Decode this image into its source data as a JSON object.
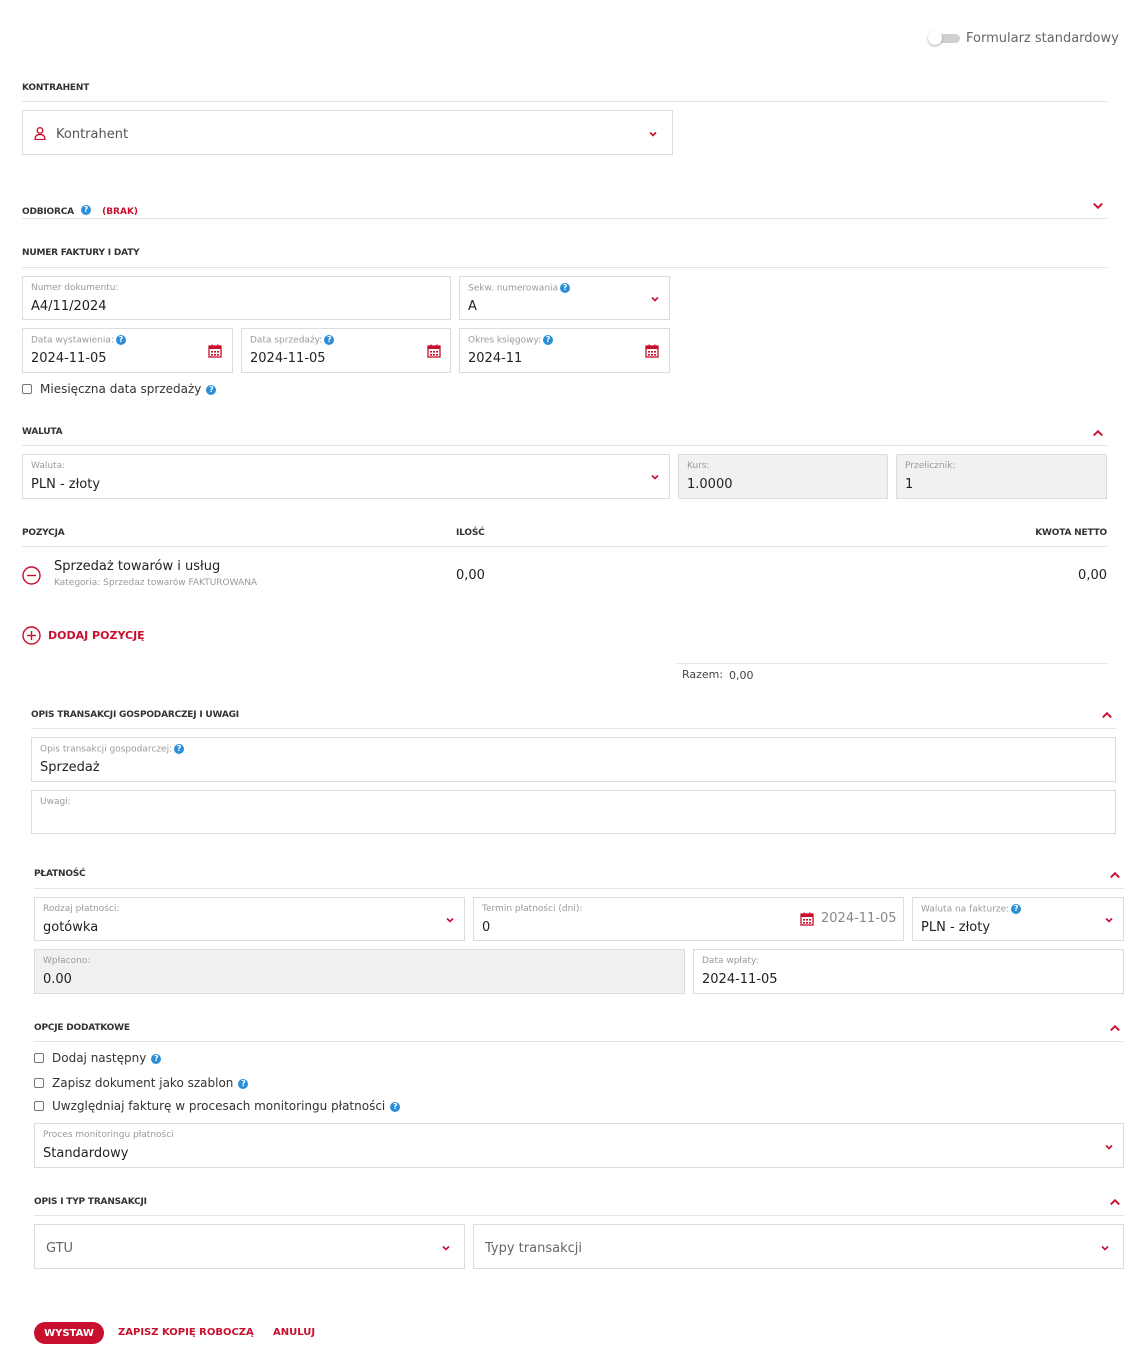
{
  "toggle": {
    "label": "Formularz standardowy"
  },
  "kontrahent": {
    "section_title": "KONTRAHENT",
    "placeholder": "Kontrahent"
  },
  "odbiorca": {
    "title": "ODBIORCA",
    "status": "(BRAK)"
  },
  "numer": {
    "section_title": "NUMER FAKTURY I DATY",
    "doc_label": "Numer dokumentu:",
    "doc_value": "A4/11/2024",
    "seq_label": "Sekw. numerowania",
    "seq_value": "A",
    "issue_label": "Data wystawienia:",
    "issue_value": "2024-11-05",
    "sale_label": "Data sprzedaży:",
    "sale_value": "2024-11-05",
    "period_label": "Okres księgowy:",
    "period_value": "2024-11",
    "monthly_label": "Miesięczna data sprzedaży"
  },
  "waluta": {
    "section_title": "WALUTA",
    "currency_label": "Waluta:",
    "currency_value": "PLN - złoty",
    "rate_label": "Kurs:",
    "rate_value": "1.0000",
    "conv_label": "Przelicznik:",
    "conv_value": "1"
  },
  "pozycje": {
    "col_pos": "POZYCJA",
    "col_qty": "ILOŚĆ",
    "col_net": "KWOTA NETTO",
    "items": [
      {
        "name": "Sprzedaż towarów i usług",
        "category": "Kategoria: Sprzedaz towarów FAKTUROWANA",
        "qty": "0,00",
        "net": "0,00"
      }
    ],
    "add_label": "DODAJ POZYCJĘ",
    "total_label": "Razem:",
    "total_value": "0,00"
  },
  "opis": {
    "section_title": "OPIS TRANSAKCJI GOSPODARCZEJ I UWAGI",
    "desc_label": "Opis transakcji gospodarczej:",
    "desc_value": "Sprzedaż",
    "notes_label": "Uwagi:"
  },
  "platnosc": {
    "section_title": "PŁATNOŚĆ",
    "type_label": "Rodzaj płatności:",
    "type_value": "gotówka",
    "term_label": "Termin płatności (dni):",
    "term_value": "0",
    "term_date": "2024-11-05",
    "inv_cur_label": "Waluta na fakturze:",
    "inv_cur_value": "PLN - złoty",
    "paid_label": "Wpłacono:",
    "paid_value": "0.00",
    "paydate_label": "Data wpłaty:",
    "paydate_value": "2024-11-05"
  },
  "opcje": {
    "section_title": "OPCJE DODATKOWE",
    "opt1": "Dodaj następny",
    "opt2": "Zapisz dokument jako szablon",
    "opt3": "Uwzględniaj fakturę w procesach monitoringu płatności",
    "proc_label": "Proces monitoringu płatności",
    "proc_value": "Standardowy"
  },
  "typ": {
    "section_title": "OPIS I TYP TRANSAKCJI",
    "gtu_placeholder": "GTU",
    "types_placeholder": "Typy transakcji"
  },
  "actions": {
    "issue": "WYSTAW",
    "draft": "ZAPISZ KOPIĘ ROBOCZĄ",
    "cancel": "ANULUJ"
  },
  "colors": {
    "accent": "#c8102e",
    "help": "#2a8fd6",
    "readonly": "#f1f1f1",
    "border": "#dcdcdc"
  }
}
